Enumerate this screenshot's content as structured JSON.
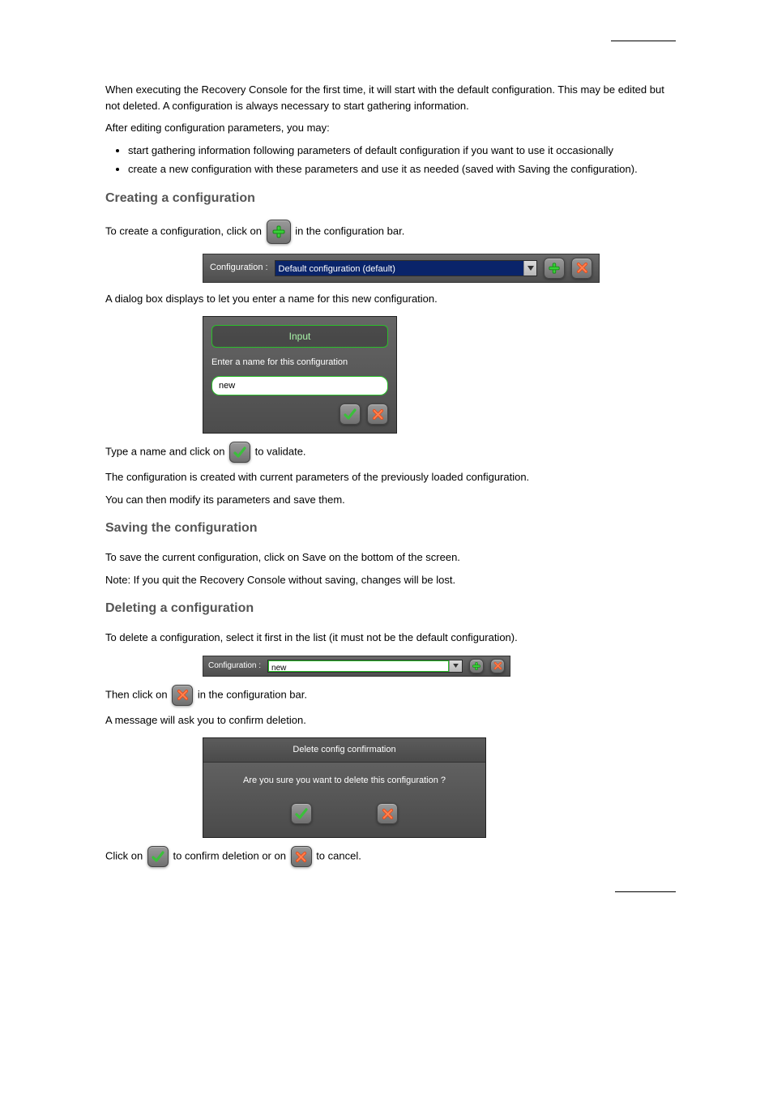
{
  "intro": {
    "p1": "When executing the Recovery Console for the first time, it will start with the default configuration. This may be edited but not deleted. A configuration is always necessary to start gathering information.",
    "p2": "After editing configuration parameters, you may:"
  },
  "list1": [
    "start gathering information following parameters of default configuration if you want to use it occasionally",
    "create a new configuration with these parameters and use it as needed (saved with Saving the configuration)."
  ],
  "sec_create_title": "Creating a configuration",
  "sec_create_p1": "To create a configuration, click on  ",
  "sec_create_p1b": "  in the configuration bar.",
  "bar1": {
    "label": "Configuration :",
    "value": "Default configuration (default)"
  },
  "sec_create_p2": "A dialog box displays to let you enter a name for this new configuration.",
  "input_dialog": {
    "title": "Input",
    "prompt": "Enter a name for this configuration",
    "value": "new"
  },
  "sec_create_p3a": "Type a name and click on ",
  "sec_create_p3b": " to validate.",
  "sec_create_p4": "The configuration is created with current parameters of the previously loaded configuration.",
  "sec_create_p5": "You can then modify its parameters and save them.",
  "sec_save_title": "Saving the configuration",
  "sec_save_p1": "To save the current configuration, click on Save on the bottom of the screen.",
  "sec_save_p2": "Note: If you quit the Recovery Console without saving, changes will be lost.",
  "sec_delete_title": "Deleting a configuration",
  "sec_delete_p1": "To delete a configuration, select it first in the list (it must not be the default configuration).",
  "bar2": {
    "label": "Configuration :",
    "value": "new"
  },
  "sec_delete_p2a": "Then click on ",
  "sec_delete_p2b": " in the configuration bar.",
  "sec_delete_p3": "A message will ask you to confirm deletion.",
  "confirm_dialog": {
    "title": "Delete config confirmation",
    "body": "Are you sure you want to delete this configuration ?"
  },
  "sec_delete_p4a": "Click on ",
  "sec_delete_p4b": " to confirm deletion or on ",
  "sec_delete_p4c": " to cancel.",
  "page_number": "",
  "icons": {
    "plus": "plus-icon",
    "cross": "cross-icon",
    "check": "check-icon"
  }
}
